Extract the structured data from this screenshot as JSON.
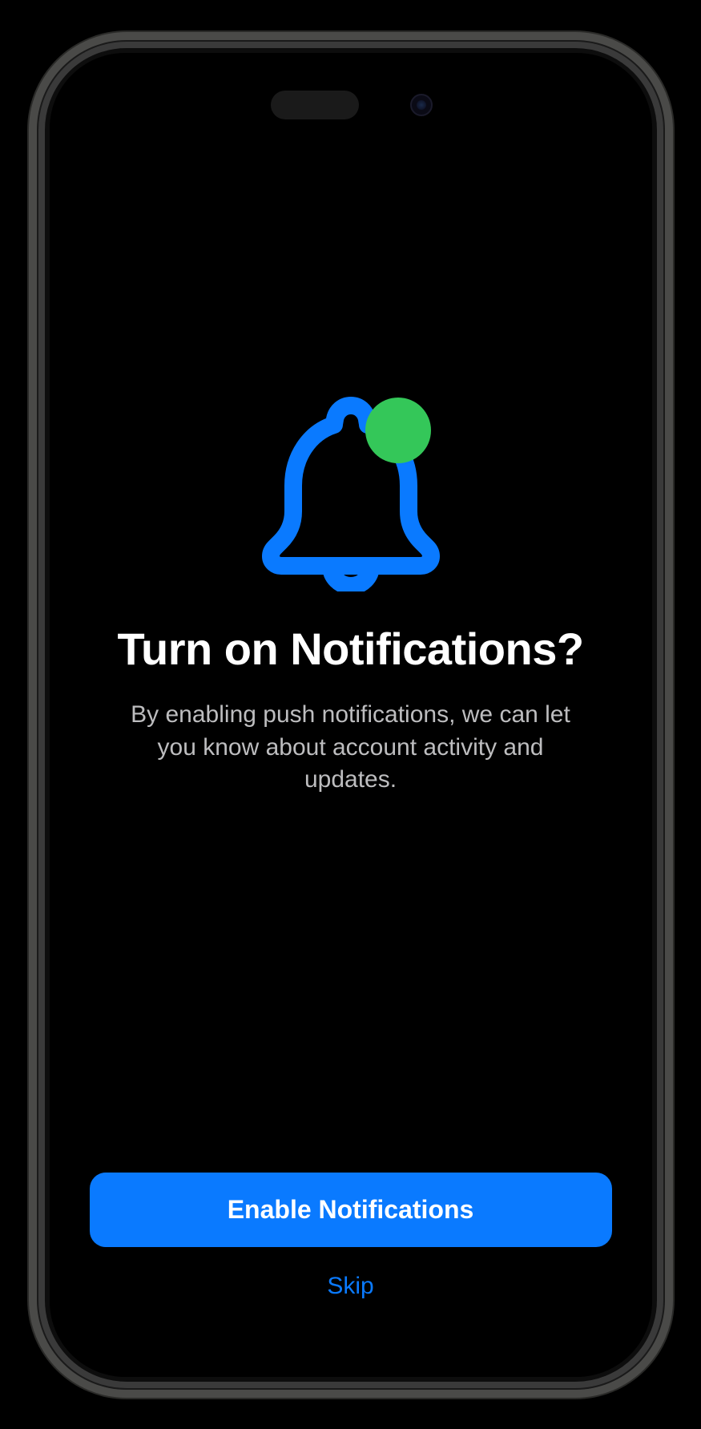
{
  "content": {
    "heading": "Turn on Notifications?",
    "description": "By enabling push notifications, we can let you know about account activity and updates."
  },
  "actions": {
    "primary_label": "Enable Notifications",
    "secondary_label": "Skip"
  },
  "icon": {
    "name": "bell-badge-icon",
    "stroke_color": "#0A7AFF",
    "badge_color": "#34C759"
  }
}
